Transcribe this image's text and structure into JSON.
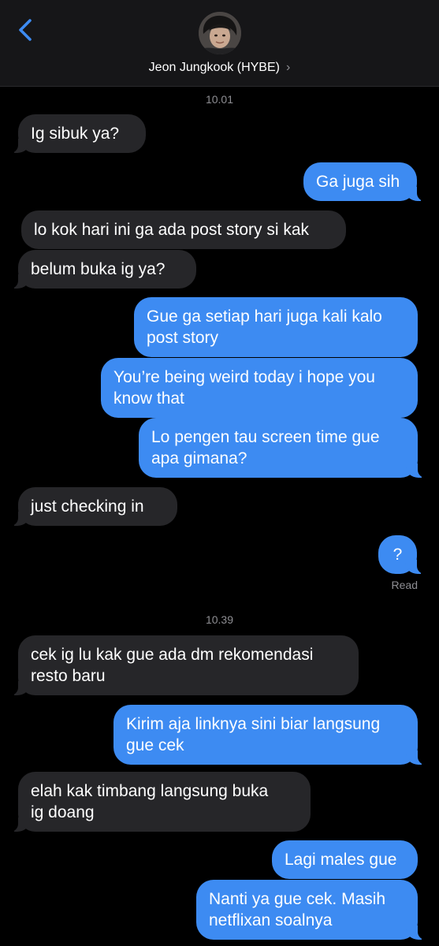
{
  "header": {
    "contact_name": "Jeon Jungkook (HYBE)",
    "chevron": "›"
  },
  "timestamps": [
    "10.01",
    "10.39"
  ],
  "messages": [
    {
      "side": "in",
      "lines": [
        "Ig sibuk ya?"
      ]
    },
    {
      "side": "out",
      "lines": [
        "Ga juga sih"
      ]
    },
    {
      "side": "in",
      "lines": [
        "lo kok hari ini ga ada post story si kak"
      ]
    },
    {
      "side": "in",
      "lines": [
        "belum buka ig ya?"
      ]
    },
    {
      "side": "out",
      "lines": [
        "Gue ga setiap hari juga kali kalo",
        "post story"
      ]
    },
    {
      "side": "out",
      "lines": [
        "You’re being weird today i hope you",
        "know that"
      ]
    },
    {
      "side": "out",
      "lines": [
        "Lo pengen tau screen time gue",
        "apa gimana?"
      ]
    },
    {
      "side": "in",
      "lines": [
        "just checking in"
      ]
    },
    {
      "side": "out",
      "lines": [
        "?"
      ]
    },
    {
      "side": "in",
      "lines": [
        "cek ig lu kak gue ada dm rekomendasi",
        "resto baru"
      ]
    },
    {
      "side": "out",
      "lines": [
        "Kirim aja linknya sini biar langsung",
        "gue cek"
      ]
    },
    {
      "side": "in",
      "lines": [
        "elah kak timbang langsung buka",
        "ig doang"
      ]
    },
    {
      "side": "out",
      "lines": [
        "Lagi males gue"
      ]
    },
    {
      "side": "out",
      "lines": [
        "Nanti ya gue cek. Masih",
        "netflixan soalnya"
      ]
    }
  ],
  "receipt": "Read",
  "colors": {
    "incoming_bubble": "#262629",
    "outgoing_bubble": "#3d8bf2",
    "back_chevron": "#3d8bf2",
    "header_bg": "#161618"
  }
}
